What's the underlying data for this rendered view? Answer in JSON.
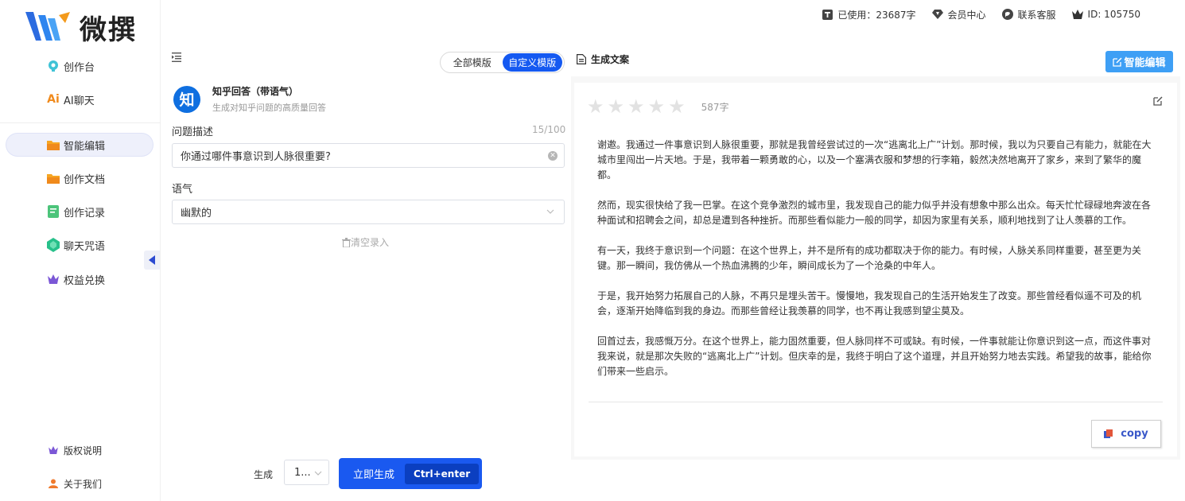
{
  "brand": {
    "name": "微撰"
  },
  "sidebar": {
    "items": [
      {
        "label": "创作台",
        "icon": "bulb-icon"
      },
      {
        "label": "AI聊天",
        "icon": "ai-icon",
        "icon_text": "Ai"
      },
      {
        "label": "智能编辑",
        "icon": "folder-icon",
        "active": true
      },
      {
        "label": "创作文档",
        "icon": "folder-icon"
      },
      {
        "label": "创作记录",
        "icon": "record-icon"
      },
      {
        "label": "聊天咒语",
        "icon": "gem-icon"
      },
      {
        "label": "权益兑换",
        "icon": "crown-icon"
      }
    ],
    "bottom_items": [
      {
        "label": "版权说明",
        "icon": "crown-icon"
      },
      {
        "label": "关于我们",
        "icon": "user-icon"
      }
    ]
  },
  "topbar": {
    "usage": "已使用：23687字",
    "member": "会员中心",
    "support": "联系客服",
    "user_id": "ID: 105750"
  },
  "template_switch": {
    "all": "全部模版",
    "custom": "自定义模版"
  },
  "template": {
    "avatar_text": "知",
    "title": "知乎回答（带语气）",
    "desc": "生成对知乎问题的高质量回答"
  },
  "form": {
    "question_label": "问题描述",
    "question_counter": "15/100",
    "question_value": "你通过哪件事意识到人脉很重要?",
    "tone_label": "语气",
    "tone_value": "幽默的",
    "clear_label": "清空录入"
  },
  "generate": {
    "label": "生成",
    "count_value": "1...",
    "button_label": "立即生成",
    "shortcut": "Ctrl+enter"
  },
  "result": {
    "title": "生成文案",
    "smart_edit": "智能编辑",
    "rating_stars": 0,
    "word_count": "587字",
    "paragraphs": [
      "谢邀。我通过一件事意识到人脉很重要，那就是我曾经尝试过的一次“逃离北上广”计划。那时候，我以为只要自己有能力，就能在大城市里闯出一片天地。于是，我带着一颗勇敢的心，以及一个塞满衣服和梦想的行李箱，毅然决然地离开了家乡，来到了繁华的魔都。",
      "然而，现实很快给了我一巴掌。在这个竞争激烈的城市里，我发现自己的能力似乎并没有想象中那么出众。每天忙忙碌碌地奔波在各种面试和招聘会之间，却总是遭到各种挫折。而那些看似能力一般的同学，却因为家里有关系，顺利地找到了让人羡慕的工作。",
      "有一天，我终于意识到一个问题：在这个世界上，并不是所有的成功都取决于你的能力。有时候，人脉关系同样重要，甚至更为关键。那一瞬间，我仿佛从一个热血沸腾的少年，瞬间成长为了一个沧桑的中年人。",
      "于是，我开始努力拓展自己的人脉，不再只是埋头苦干。慢慢地，我发现自己的生活开始发生了改变。那些曾经看似遥不可及的机会，逐渐开始降临到我的身边。而那些曾经让我羡慕的同学，也不再让我感到望尘莫及。",
      "回首过去，我感慨万分。在这个世界上，能力固然重要，但人脉同样不可或缺。有时候，一件事就能让你意识到这一点，而这件事对我来说，就是那次失败的“逃离北上广”计划。但庆幸的是，我终于明白了这个道理，并且开始努力地去实践。希望我的故事，能给你们带来一些启示。"
    ],
    "copy_label": "copy"
  },
  "colors": {
    "primary": "#1a59f0",
    "accent": "#3e9ff5",
    "active_bg": "#eef0fb"
  }
}
